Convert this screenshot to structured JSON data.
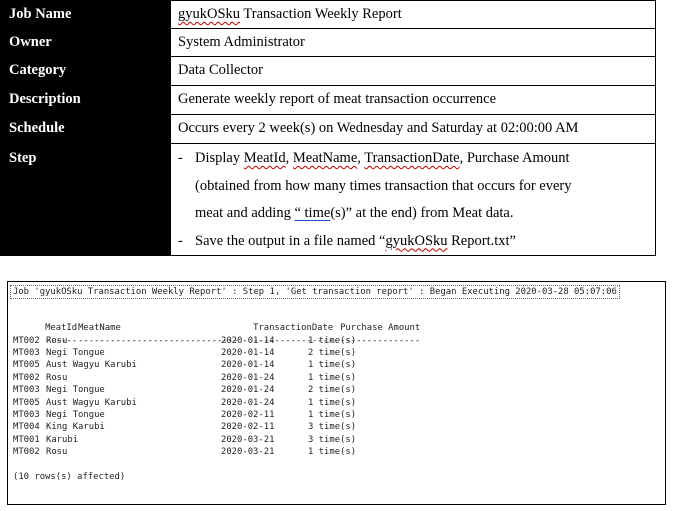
{
  "spec": {
    "job_name": {
      "label": "Job Name",
      "value_prefix": "gyukOSku",
      "value_rest": " Transaction Weekly Report"
    },
    "owner": {
      "label": "Owner",
      "value": "System Administrator"
    },
    "category": {
      "label": "Category",
      "value": "Data Collector"
    },
    "description": {
      "label": "Description",
      "value": "Generate weekly report of meat transaction occurrence"
    },
    "schedule": {
      "label": "Schedule",
      "value": "Occurs every 2 week(s) on Wednesday and Saturday at 02:00:00 AM"
    },
    "step": {
      "label": "Step",
      "bullet": "-",
      "b1": {
        "a": "Display ",
        "meatid": "MeatId",
        "s1": ", ",
        "meatname": "MeatName",
        "s2": ", ",
        "transdate": "TransactionDate",
        "b": ", Purchase Amount",
        "c": "(obtained from how many times transaction that occurs for every",
        "d": "meat and adding ",
        "e": "“ time",
        "f": "(s)” at the end) from Meat data."
      },
      "b2": {
        "a": "Save the output in a file named “",
        "name": "gyukOSku",
        "b": " Report.txt”"
      }
    }
  },
  "console": {
    "header": "Job 'gyukOSku Transaction Weekly Report' : Step 1, 'Get transaction report' : Began Executing 2020-03-28 05:07:06",
    "columns": [
      "MeatId",
      "MeatName",
      "TransactionDate",
      "Purchase Amount"
    ],
    "separators": [
      "------",
      "------------------------------",
      "---------------",
      "---------------"
    ],
    "rows": [
      [
        "MT002",
        "Rosu",
        "2020-01-14",
        "1 time(s)"
      ],
      [
        "MT003",
        "Negi Tongue",
        "2020-01-14",
        "2 time(s)"
      ],
      [
        "MT005",
        "Aust Wagyu Karubi",
        "2020-01-14",
        "1 time(s)"
      ],
      [
        "MT002",
        "Rosu",
        "2020-01-24",
        "1 time(s)"
      ],
      [
        "MT003",
        "Negi Tongue",
        "2020-01-24",
        "2 time(s)"
      ],
      [
        "MT005",
        "Aust Wagyu Karubi",
        "2020-01-24",
        "1 time(s)"
      ],
      [
        "MT003",
        "Negi Tongue",
        "2020-02-11",
        "1 time(s)"
      ],
      [
        "MT004",
        "King Karubi",
        "2020-02-11",
        "3 time(s)"
      ],
      [
        "MT001",
        "Karubi",
        "2020-03-21",
        "3 time(s)"
      ],
      [
        "MT002",
        "Rosu",
        "2020-03-21",
        "1 time(s)"
      ]
    ],
    "footer": "(10 rows(s) affected)"
  }
}
